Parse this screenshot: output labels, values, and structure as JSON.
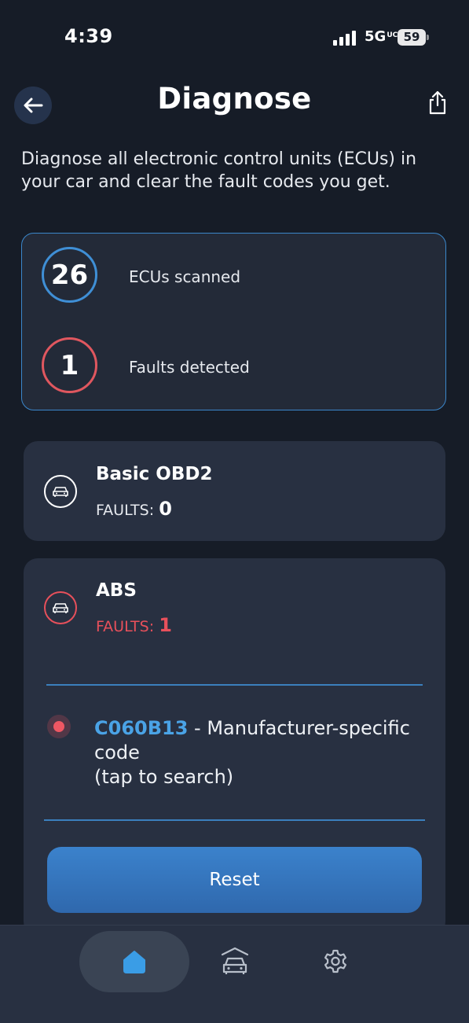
{
  "status_bar": {
    "time": "4:39",
    "network": "5G",
    "network_suffix": "UC",
    "battery": "59"
  },
  "header": {
    "back_icon": "arrow-left-icon",
    "title": "Diagnose",
    "share_icon": "share-icon"
  },
  "intro": "Diagnose all electronic control units (ECUs) in your car and clear the fault codes you get.",
  "summary": {
    "ecus_scanned_count": "26",
    "ecus_scanned_label": "ECUs scanned",
    "faults_detected_count": "1",
    "faults_detected_label": "Faults detected"
  },
  "ecus": [
    {
      "name": "Basic OBD2",
      "faults_label": "FAULTS:",
      "faults_count": "0",
      "icon": "car-icon",
      "status_color": "#ffffff"
    },
    {
      "name": "ABS",
      "faults_label": "FAULTS:",
      "faults_count": "1",
      "icon": "car-icon",
      "status_color": "#e8505b",
      "codes": [
        {
          "code": "C060B13",
          "description": " - Manufacturer-specific code",
          "hint": "(tap to search)"
        }
      ],
      "reset_label": "Reset"
    }
  ],
  "tab_bar": {
    "tabs": [
      {
        "name": "home",
        "icon": "home-icon",
        "active": true
      },
      {
        "name": "vehicle",
        "icon": "car-garage-icon",
        "active": false
      },
      {
        "name": "settings",
        "icon": "gear-icon",
        "active": false
      }
    ]
  },
  "colors": {
    "background": "#161c27",
    "card": "#283041",
    "accent_blue": "#3f8fd6",
    "fault_red": "#e8505b"
  }
}
